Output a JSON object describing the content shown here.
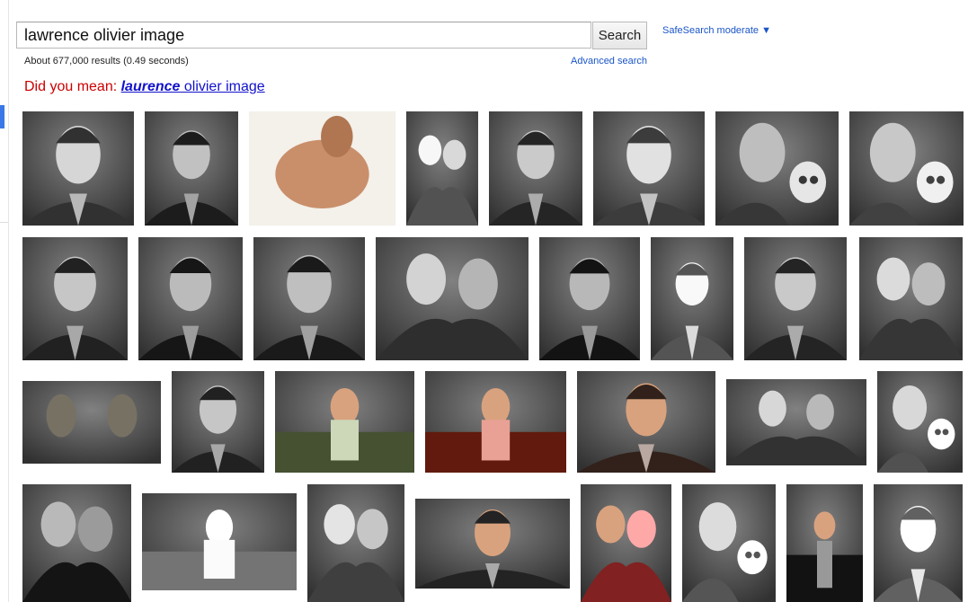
{
  "search": {
    "query": "lawrence olivier image",
    "button_label": "Search"
  },
  "safesearch": {
    "label": "SafeSearch moderate ▼"
  },
  "results": {
    "count_text": "About 677,000 results (0.49 seconds)",
    "advanced_link": "Advanced search"
  },
  "suggestion": {
    "prefix": "Did you mean: ",
    "corrected_word": "laurence",
    "rest": " olivier image"
  },
  "images": [
    {
      "tone": "#4a4a4a",
      "kind": "portrait"
    },
    {
      "tone": "#353535",
      "kind": "portrait"
    },
    {
      "tone": "#c98f6a",
      "kind": "color-figure"
    },
    {
      "tone": "#6b6b6b",
      "kind": "couple"
    },
    {
      "tone": "#3e3e3e",
      "kind": "portrait"
    },
    {
      "tone": "#555555",
      "kind": "portrait"
    },
    {
      "tone": "#505050",
      "kind": "skull"
    },
    {
      "tone": "#5a5a5a",
      "kind": "skull"
    },
    {
      "tone": "#3a3a3a",
      "kind": "portrait"
    },
    {
      "tone": "#2f2f2f",
      "kind": "portrait"
    },
    {
      "tone": "#333333",
      "kind": "portrait"
    },
    {
      "tone": "#474747",
      "kind": "couple"
    },
    {
      "tone": "#2c2c2c",
      "kind": "portrait"
    },
    {
      "tone": "#6d6d6d",
      "kind": "portrait"
    },
    {
      "tone": "#3d3d3d",
      "kind": "portrait"
    },
    {
      "tone": "#4f4f4f",
      "kind": "couple"
    },
    {
      "tone": "#3a3527",
      "kind": "statue"
    },
    {
      "tone": "#3a3a3a",
      "kind": "portrait"
    },
    {
      "tone": "#5e6a4a",
      "kind": "color-scene"
    },
    {
      "tone": "#7a3326",
      "kind": "color-scene"
    },
    {
      "tone": "#4a3a33",
      "kind": "color-portrait"
    },
    {
      "tone": "#4b4b4b",
      "kind": "couple"
    },
    {
      "tone": "#6a6a6a",
      "kind": "skull"
    },
    {
      "tone": "#2d2d2d",
      "kind": "couple"
    },
    {
      "tone": "#8d8d8d",
      "kind": "scene"
    },
    {
      "tone": "#585858",
      "kind": "couple"
    },
    {
      "tone": "#3c3c3c",
      "kind": "color-portrait"
    },
    {
      "tone": "#9a3a3a",
      "kind": "color-couple"
    },
    {
      "tone": "#6e6e6e",
      "kind": "skull"
    },
    {
      "tone": "#2b2b2b",
      "kind": "color-scene"
    },
    {
      "tone": "#7a7a7a",
      "kind": "portrait"
    }
  ]
}
